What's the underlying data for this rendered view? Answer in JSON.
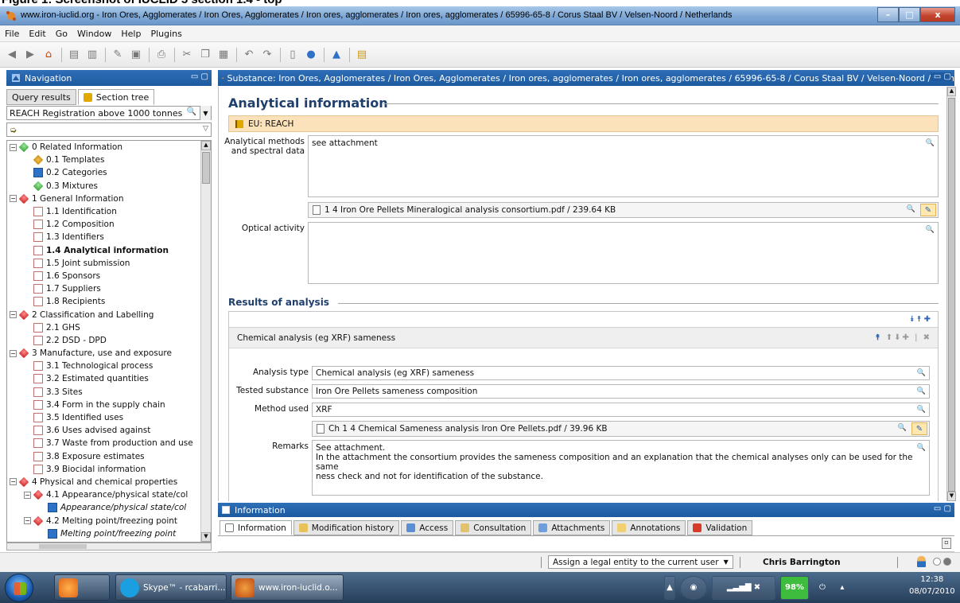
{
  "caption": "Figure 1: Screenshot of IUCLID 5 section 1.4 - top",
  "window": {
    "title": "www.iron-iuclid.org - Iron Ores, Agglomerates / Iron Ores, Agglomerates / Iron ores, agglomerates  / Iron ores, agglomerates  / 65996-65-8 / Corus Staal BV / Velsen-Noord / Netherlands",
    "minimize": "–",
    "maximize": "□",
    "close": "x"
  },
  "menu": [
    "File",
    "Edit",
    "Go",
    "Window",
    "Help",
    "Plugins"
  ],
  "navigation": {
    "title": "Navigation",
    "tabs": [
      "Query results",
      "Section tree"
    ],
    "filter_value": "REACH Registration above 1000 tonnes",
    "tree": [
      {
        "indent": 0,
        "exp": "−",
        "icon": "green",
        "label": "0 Related Information"
      },
      {
        "indent": 1,
        "icon": "template",
        "label": "0.1 Templates"
      },
      {
        "indent": 1,
        "icon": "categories",
        "label": "0.2 Categories"
      },
      {
        "indent": 1,
        "icon": "mixtures",
        "label": "0.3 Mixtures"
      },
      {
        "indent": 0,
        "exp": "−",
        "icon": "red",
        "label": "1 General Information"
      },
      {
        "indent": 1,
        "icon": "doc",
        "label": "1.1 Identification"
      },
      {
        "indent": 1,
        "icon": "doc",
        "label": "1.2 Composition"
      },
      {
        "indent": 1,
        "icon": "doc",
        "label": "1.3 Identifiers"
      },
      {
        "indent": 1,
        "icon": "doc",
        "label": "1.4 Analytical information",
        "bold": true
      },
      {
        "indent": 1,
        "icon": "doc",
        "label": "1.5 Joint submission"
      },
      {
        "indent": 1,
        "icon": "doc",
        "label": "1.6 Sponsors"
      },
      {
        "indent": 1,
        "icon": "doc",
        "label": "1.7 Suppliers"
      },
      {
        "indent": 1,
        "icon": "doc",
        "label": "1.8 Recipients"
      },
      {
        "indent": 0,
        "exp": "−",
        "icon": "red",
        "label": "2 Classification and Labelling"
      },
      {
        "indent": 1,
        "icon": "doc",
        "label": "2.1 GHS"
      },
      {
        "indent": 1,
        "icon": "doc",
        "label": "2.2 DSD - DPD"
      },
      {
        "indent": 0,
        "exp": "−",
        "icon": "red",
        "label": "3 Manufacture, use and exposure"
      },
      {
        "indent": 1,
        "icon": "doc",
        "label": "3.1 Technological process"
      },
      {
        "indent": 1,
        "icon": "doc",
        "label": "3.2 Estimated quantities"
      },
      {
        "indent": 1,
        "icon": "doc",
        "label": "3.3 Sites"
      },
      {
        "indent": 1,
        "icon": "doc",
        "label": "3.4 Form in the supply chain"
      },
      {
        "indent": 1,
        "icon": "doc",
        "label": "3.5 Identified uses"
      },
      {
        "indent": 1,
        "icon": "doc",
        "label": "3.6 Uses advised against"
      },
      {
        "indent": 1,
        "icon": "doc",
        "label": "3.7 Waste from production and use"
      },
      {
        "indent": 1,
        "icon": "doc",
        "label": "3.8 Exposure estimates"
      },
      {
        "indent": 1,
        "icon": "doc",
        "label": "3.9 Biocidal information"
      },
      {
        "indent": 0,
        "exp": "−",
        "icon": "red",
        "label": "4 Physical and chemical properties"
      },
      {
        "indent": 1,
        "exp": "−",
        "icon": "red",
        "label": "4.1 Appearance/physical state/col"
      },
      {
        "indent": 2,
        "icon": "blue",
        "label": "Appearance/physical state/col",
        "italic": true
      },
      {
        "indent": 1,
        "exp": "−",
        "icon": "red",
        "label": "4.2 Melting point/freezing point"
      },
      {
        "indent": 2,
        "icon": "blue",
        "label": "Melting point/freezing point",
        "italic": true
      }
    ]
  },
  "substance": {
    "header": "Substance: Iron Ores, Agglomerates / Iron Ores, Agglomerates / Iron ores, agglomerates  / Iron ores, agglomerates  / 65996-65-8 / Corus Staal BV / Velsen-Noord / Neth",
    "section_title": "Analytical information",
    "eu_label": "EU: REACH",
    "analytical_methods_label": "Analytical methods and spectral data",
    "analytical_methods_value": "see attachment",
    "attachment_1": "1 4 Iron Ore Pellets Mineralogical analysis consortium.pdf / 239.64 KB",
    "optical_activity_label": "Optical activity",
    "optical_activity_value": "",
    "results_title": "Results of analysis",
    "block_title": "Chemical analysis (eg XRF) sameness",
    "analysis_type_label": "Analysis type",
    "analysis_type_value": "Chemical analysis (eg XRF) sameness",
    "tested_substance_label": "Tested substance",
    "tested_substance_value": "Iron Ore Pellets sameness composition",
    "method_used_label": "Method used",
    "method_used_value": "XRF",
    "attachment_2": "Ch 1 4 Chemical Sameness analysis Iron Ore Pellets.pdf / 39.96 KB",
    "remarks_label": "Remarks",
    "remarks_line1": "See attachment.",
    "remarks_line2": "In the attachment the consortium provides the sameness composition and an explanation that the chemical analyses only can be used for the same",
    "remarks_line3": "ness check and not for identification of the substance."
  },
  "info_panel": {
    "title": "Information",
    "tabs": [
      "Information",
      "Modification history",
      "Access",
      "Consultation",
      "Attachments",
      "Annotations",
      "Validation"
    ]
  },
  "status": {
    "assign": "Assign a legal entity to the current user",
    "user": "Chris Barrington"
  },
  "taskbar": {
    "skype": "Skype™ - rcabarri...",
    "browser": "www.iron-iuclid.o...",
    "battery": "98%",
    "time": "12:38",
    "date": "08/07/2010"
  },
  "colors": {
    "panel_header": "#1d5aa0",
    "section_title": "#1f3f6c",
    "eu_bar": "#fbe2ba"
  }
}
